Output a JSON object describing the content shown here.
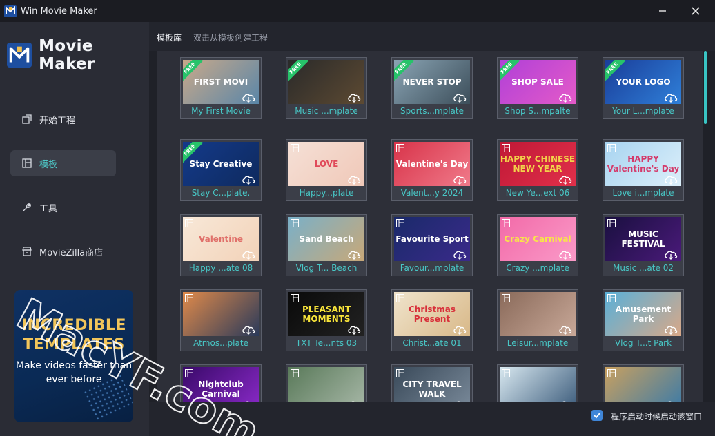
{
  "window": {
    "title": "Win Movie Maker"
  },
  "colors": {
    "accent": "#48c7c6",
    "free_badge": "#27c36a",
    "checkbox": "#3f86d8"
  },
  "brand": {
    "name": "Movie Maker"
  },
  "sidebar": {
    "items": [
      {
        "label": "开始工程",
        "icon": "new-project-icon"
      },
      {
        "label": "模板",
        "icon": "template-icon",
        "active": true
      },
      {
        "label": "工具",
        "icon": "tools-icon"
      },
      {
        "label": "MovieZilla商店",
        "icon": "store-icon"
      }
    ]
  },
  "promo": {
    "headline": "INCREDIBLE TEMPLATES",
    "subtext": "Make videos faster than ever before"
  },
  "header": {
    "current": "模板库",
    "hint": "双击从模板创建工程"
  },
  "footer": {
    "checkbox_label": "程序启动时候启动该窗口",
    "checked": true
  },
  "templates": [
    {
      "label": "My First Movie",
      "thumb_text": "FIRST MOVI",
      "free": true
    },
    {
      "label": "Music ...mplate",
      "thumb_text": "",
      "free": true
    },
    {
      "label": "Sports...mplate",
      "thumb_text": "NEVER STOP",
      "free": true
    },
    {
      "label": "Shop S...mpalte",
      "thumb_text": "SHOP SALE",
      "free": true
    },
    {
      "label": "Your L...mplate",
      "thumb_text": "YOUR LOGO",
      "free": true
    },
    {
      "label": "Stay C...plate.",
      "thumb_text": "Stay Creative",
      "free": true
    },
    {
      "label": "Happy...plate",
      "thumb_text": "LOVE",
      "free": false
    },
    {
      "label": "Valent...y 2024",
      "thumb_text": "Valentine's Day",
      "free": false
    },
    {
      "label": "New Ye...ext 06",
      "thumb_text": "HAPPY CHINESE NEW YEAR",
      "free": false
    },
    {
      "label": "Love i...mplate",
      "thumb_text": "HAPPY Valentine's Day",
      "free": false
    },
    {
      "label": "Happy ...ate 08",
      "thumb_text": "Valentine",
      "free": false
    },
    {
      "label": "Vlog T... Beach",
      "thumb_text": "Sand Beach",
      "free": false
    },
    {
      "label": "Favour...mplate",
      "thumb_text": "Favourite Sport",
      "free": false
    },
    {
      "label": "Crazy ...mplate",
      "thumb_text": "Crazy Carnival",
      "free": false
    },
    {
      "label": "Music ...ate 02",
      "thumb_text": "MUSIC FESTIVAL",
      "free": false
    },
    {
      "label": "Atmos...plate",
      "thumb_text": "",
      "free": false
    },
    {
      "label": "TXT Te...nts 03",
      "thumb_text": "PLEASANT MOMENTS",
      "free": false
    },
    {
      "label": "Christ...ate 01",
      "thumb_text": "Christmas Present",
      "free": false
    },
    {
      "label": "Leisur...mplate",
      "thumb_text": "",
      "free": false
    },
    {
      "label": "Vlog T...t Park",
      "thumb_text": "Amusement Park",
      "free": false
    },
    {
      "label": "",
      "thumb_text": "Nightclub Carnival",
      "free": false
    },
    {
      "label": "",
      "thumb_text": "",
      "free": false
    },
    {
      "label": "",
      "thumb_text": "CITY TRAVEL WALK",
      "free": false
    },
    {
      "label": "",
      "thumb_text": "",
      "free": false
    },
    {
      "label": "",
      "thumb_text": "",
      "free": false
    }
  ],
  "watermark": {
    "text": "MacYF.com"
  }
}
